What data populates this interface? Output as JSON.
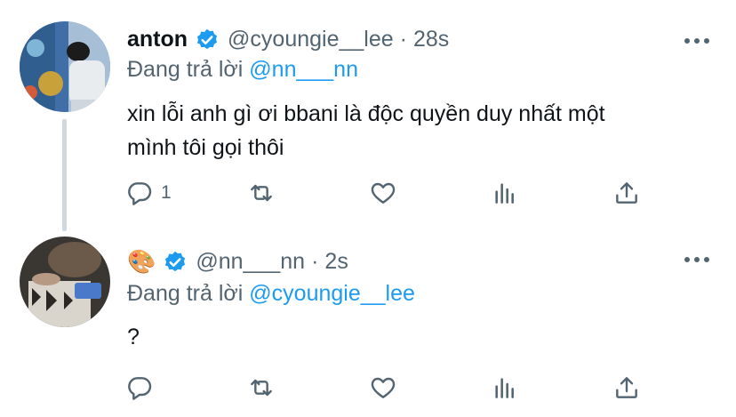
{
  "tweets": [
    {
      "name": "anton",
      "handle": "@cyoungie__lee",
      "time": "28s",
      "replying_prefix": "Đang trả lời ",
      "replying_to": "@nn___nn",
      "text_line1": "xin lỗi anh gì ơi bbani là độc quyền duy nhất một",
      "text_line2": "mình tôi gọi thôi",
      "reply_count": "1"
    },
    {
      "name_emoji": "🎨",
      "handle": "@nn___nn",
      "time": "2s",
      "replying_prefix": "Đang trả lời ",
      "replying_to": "@cyoungie__lee",
      "text": "?"
    }
  ],
  "separator": "·",
  "icons": [
    "reply-icon",
    "retweet-icon",
    "like-icon",
    "analytics-icon",
    "share-icon",
    "verified-badge-icon",
    "more-icon"
  ],
  "colors": {
    "link": "#1d9bf0",
    "muted": "#536471",
    "verified": "#1d9bf0",
    "text": "#0f1419"
  }
}
